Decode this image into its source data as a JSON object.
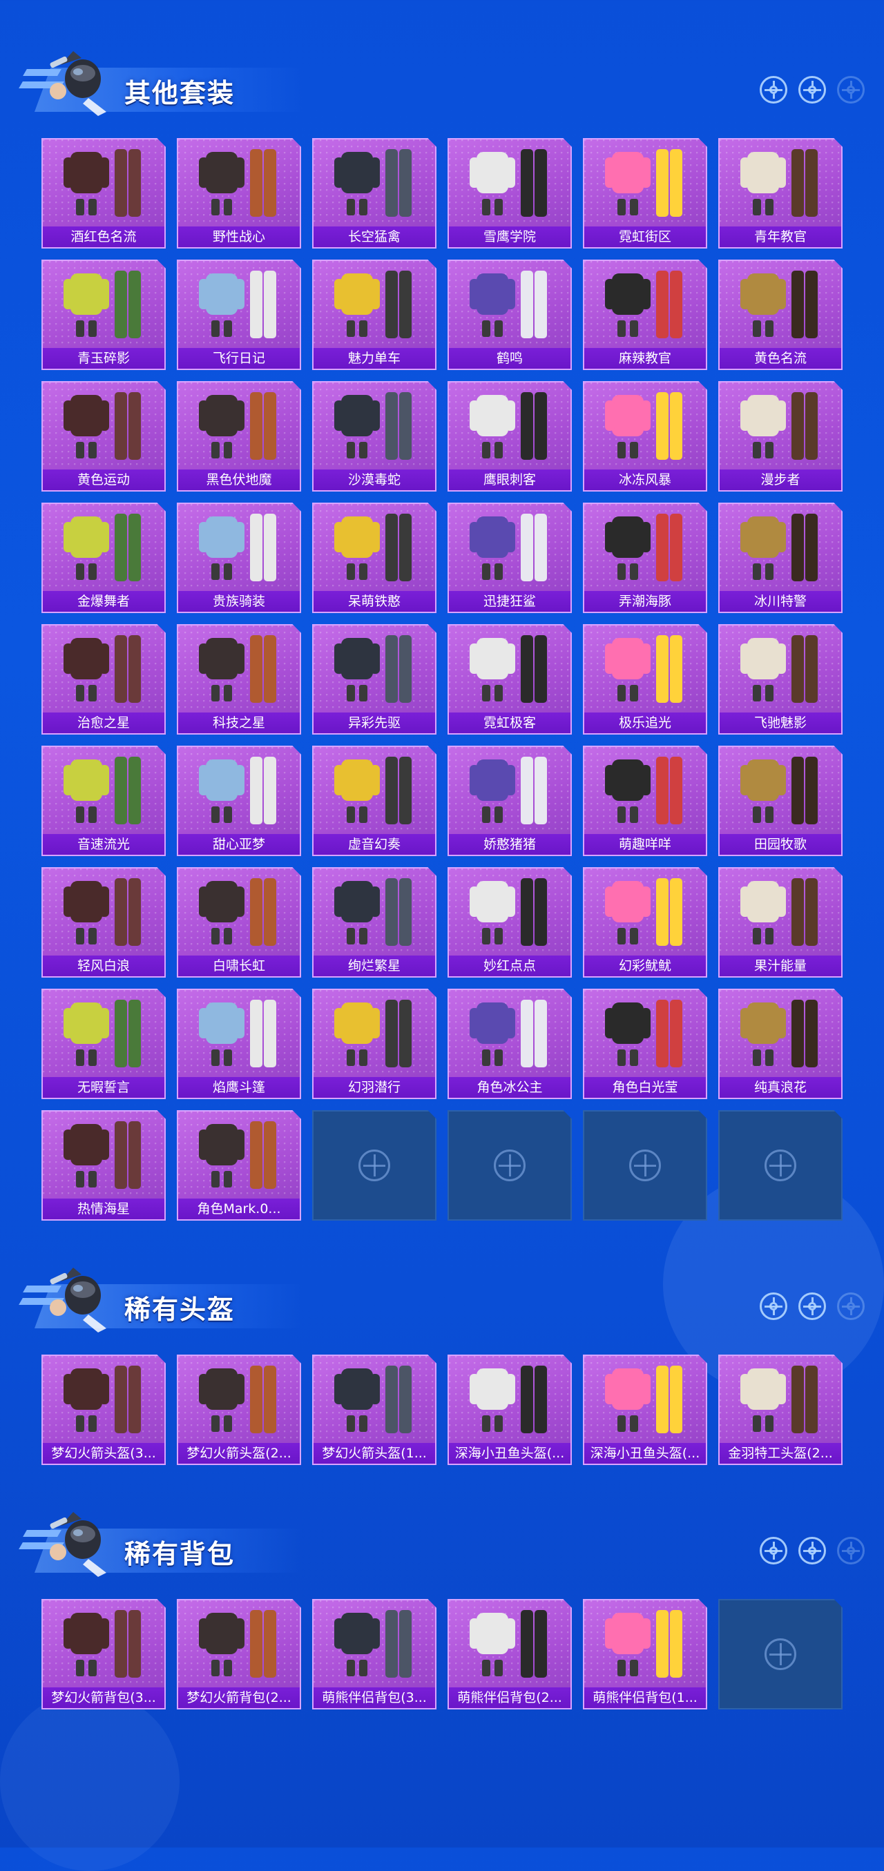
{
  "sections": [
    {
      "title": "其他套装",
      "items": [
        "酒红色名流",
        "野性战心",
        "长空猛禽",
        "雪鹰学院",
        "霓虹街区",
        "青年教官",
        "青玉碎影",
        "飞行日记",
        "魅力单车",
        "鹤鸣",
        "麻辣教官",
        "黄色名流",
        "黄色运动",
        "黑色伏地魔",
        "沙漠毒蛇",
        "鹰眼刺客",
        "冰冻风暴",
        "漫步者",
        "金爆舞者",
        "贵族骑装",
        "呆萌铁憨",
        "迅捷狂鲨",
        "弄潮海豚",
        "冰川特警",
        "治愈之星",
        "科技之星",
        "异彩先驱",
        "霓虹极客",
        "极乐追光",
        "飞驰魅影",
        "音速流光",
        "甜心亚梦",
        "虚音幻奏",
        "娇憨猪猪",
        "萌趣咩咩",
        "田园牧歌",
        "轻风白浪",
        "白啸长虹",
        "绚烂繁星",
        "妙红点点",
        "幻彩鱿鱿",
        "果汁能量",
        "无暇誓言",
        "焰鹰斗篷",
        "幻羽潜行",
        "角色冰公主",
        "角色白光莹",
        "纯真浪花",
        "热情海星",
        "角色Mark.0..."
      ],
      "empty_slots": 4
    },
    {
      "title": "稀有头盔",
      "items": [
        "梦幻火箭头盔(3...",
        "梦幻火箭头盔(2...",
        "梦幻火箭头盔(1...",
        "深海小丑鱼头盔(...",
        "深海小丑鱼头盔(...",
        "金羽特工头盔(2..."
      ],
      "empty_slots": 0
    },
    {
      "title": "稀有背包",
      "items": [
        "梦幻火箭背包(3...",
        "梦幻火箭背包(2...",
        "萌熊伴侣背包(3...",
        "萌熊伴侣背包(2...",
        "萌熊伴侣背包(1..."
      ],
      "empty_slots": 1
    }
  ],
  "colors": {
    "background": "#0b52dc",
    "card": "#b05ddd",
    "label_bar": "#7a1fd8",
    "empty_slot": "#1d4c8e"
  }
}
